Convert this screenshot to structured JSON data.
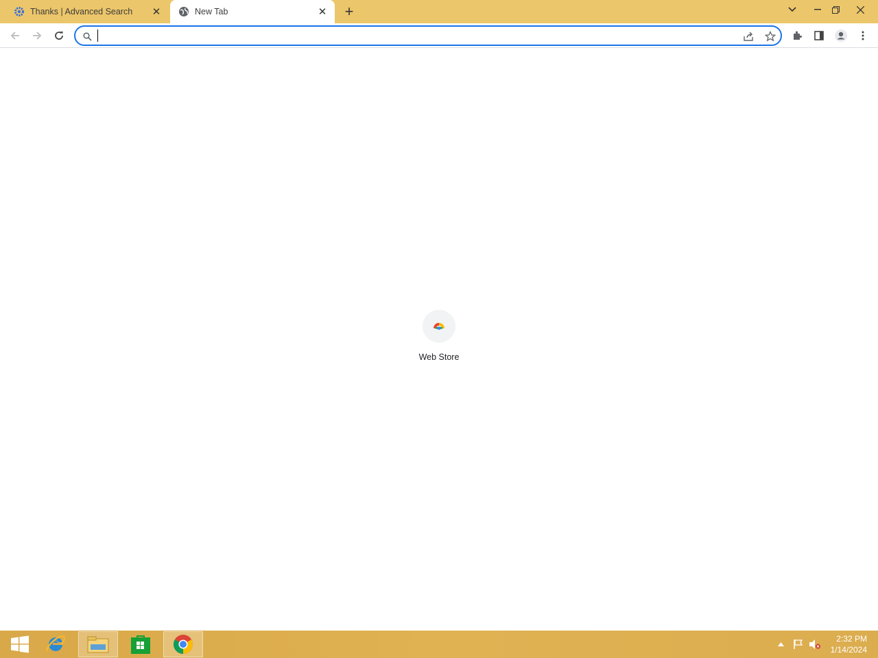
{
  "tabs": [
    {
      "title": "Thanks | Advanced Search",
      "icon": "gear-favicon-icon"
    },
    {
      "title": "New Tab",
      "icon": "globe-icon"
    }
  ],
  "omnibox": {
    "value": "",
    "placeholder": ""
  },
  "shortcuts": [
    {
      "label": "Web Store",
      "icon": "web-store-icon"
    }
  ],
  "taskbar": {
    "apps": [
      "windows-start-icon",
      "internet-explorer-icon",
      "file-explorer-icon",
      "store-icon",
      "chrome-icon"
    ]
  },
  "clock": {
    "time": "2:32 PM",
    "date": "1/14/2024"
  },
  "colors": {
    "tabstrip": "#ecc66a",
    "accent": "#1a73e8",
    "taskbar": "#dcad4f"
  }
}
